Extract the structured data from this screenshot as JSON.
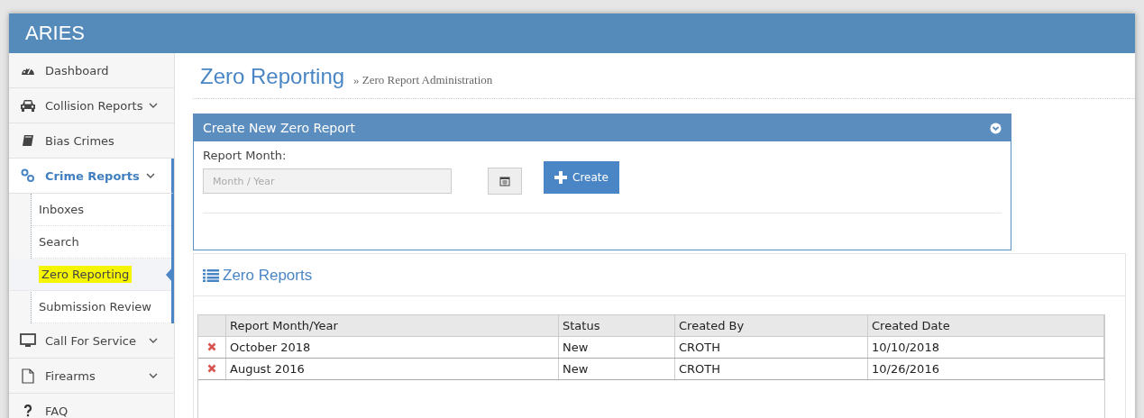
{
  "app": {
    "title": "ARIES"
  },
  "sidebar": {
    "items": [
      {
        "label": "Dashboard",
        "selected": false,
        "chevron": false
      },
      {
        "label": "Collision Reports",
        "selected": false,
        "chevron": true
      },
      {
        "label": "Bias Crimes",
        "selected": false,
        "chevron": false
      },
      {
        "label": "Crime Reports",
        "selected": true,
        "chevron": true,
        "children": [
          {
            "label": "Inboxes",
            "selected": false
          },
          {
            "label": "Search",
            "selected": false
          },
          {
            "label": "Zero Reporting",
            "selected": true
          },
          {
            "label": "Submission Review",
            "selected": false
          }
        ]
      },
      {
        "label": "Call For Service",
        "selected": false,
        "chevron": true
      },
      {
        "label": "Firearms",
        "selected": false,
        "chevron": true
      },
      {
        "label": "FAQ",
        "selected": false,
        "chevron": false
      }
    ]
  },
  "page": {
    "title": "Zero Reporting",
    "breadcrumb": "» Zero Report Administration"
  },
  "create_panel": {
    "title": "Create New Zero Report",
    "field_label": "Report Month:",
    "placeholder": "Month / Year",
    "button": "Create"
  },
  "reports": {
    "title": "Zero Reports",
    "columns": [
      "Report Month/Year",
      "Status",
      "Created By",
      "Created Date"
    ],
    "rows": [
      [
        "October 2018",
        "New",
        "CROTH",
        "10/10/2018"
      ],
      [
        "August 2016",
        "New",
        "CROTH",
        "10/26/2016"
      ]
    ]
  }
}
